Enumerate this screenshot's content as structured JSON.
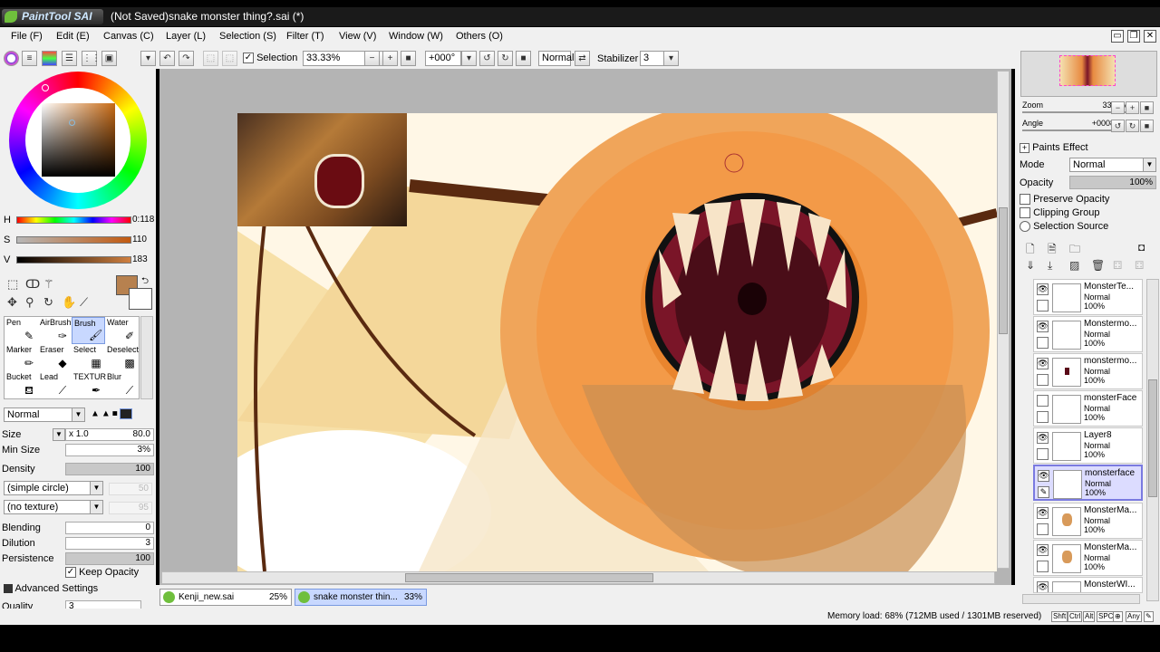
{
  "app": {
    "logo_text": "PaintTool SAI",
    "window_title": "(Not Saved)snake monster thing?.sai (*)"
  },
  "menu": [
    "File (F)",
    "Edit (E)",
    "Canvas (C)",
    "Layer (L)",
    "Selection (S)",
    "Filter (T)",
    "View (V)",
    "Window (W)",
    "Others (O)"
  ],
  "toolbar": {
    "selection_label": "Selection",
    "zoom": "33.33%",
    "angle": "+000°",
    "blend_mode": "Normal",
    "stabilizer_label": "Stabilizer",
    "stabilizer_value": "3"
  },
  "color": {
    "h_label": "H",
    "h_value": "0:118",
    "s_label": "S",
    "s_value": "110",
    "v_label": "V",
    "v_value": "183",
    "primary": "#b7814f"
  },
  "tools": [
    {
      "name": "Pen",
      "icon": "pen-icon"
    },
    {
      "name": "AirBrush",
      "icon": "airbrush-icon"
    },
    {
      "name": "Brush",
      "icon": "brush-icon"
    },
    {
      "name": "Water",
      "icon": "water-icon"
    },
    {
      "name": "Marker",
      "icon": "marker-icon"
    },
    {
      "name": "Eraser",
      "icon": "eraser-icon"
    },
    {
      "name": "Select",
      "icon": "select-icon"
    },
    {
      "name": "Deselect",
      "icon": "deselect-icon"
    },
    {
      "name": "Bucket",
      "icon": "bucket-icon"
    },
    {
      "name": "Lead",
      "icon": "lead-icon"
    },
    {
      "name": "TEXTUR",
      "icon": "texture-icon"
    },
    {
      "name": "Blur",
      "icon": "blur-icon"
    }
  ],
  "brush": {
    "mode": "Normal",
    "size_label": "Size",
    "size_mult": "x 1.0",
    "size_value": "80.0",
    "min_size_label": "Min Size",
    "min_size_value": "3%",
    "density_label": "Density",
    "density_value": "100",
    "shape": "(simple circle)",
    "shape_value": "50",
    "texture": "(no texture)",
    "texture_value": "95",
    "blending_label": "Blending",
    "blending_value": "0",
    "dilution_label": "Dilution",
    "dilution_value": "3",
    "persistence_label": "Persistence",
    "persistence_value": "100",
    "keep_opacity": "Keep Opacity",
    "advanced": "Advanced Settings",
    "quality_label": "Quality",
    "quality_value": "3"
  },
  "navigator": {
    "zoom_label": "Zoom",
    "zoom_value": "33.3%",
    "angle_label": "Angle",
    "angle_value": "+0008"
  },
  "layer_props": {
    "paints_effect": "Paints Effect",
    "mode_label": "Mode",
    "mode_value": "Normal",
    "opacity_label": "Opacity",
    "opacity_value": "100%",
    "preserve_opacity": "Preserve Opacity",
    "clipping_group": "Clipping Group",
    "selection_source": "Selection Source"
  },
  "layers": [
    {
      "name": "MonsterTe...",
      "mode": "Normal",
      "opacity": "100%"
    },
    {
      "name": "Monstermo...",
      "mode": "Normal",
      "opacity": "100%"
    },
    {
      "name": "monstermo...",
      "mode": "Normal",
      "opacity": "100%"
    },
    {
      "name": "monsterFace",
      "mode": "Normal",
      "opacity": "100%"
    },
    {
      "name": "Layer8",
      "mode": "Normal",
      "opacity": "100%"
    },
    {
      "name": "monsterface",
      "mode": "Normal",
      "opacity": "100%"
    },
    {
      "name": "MonsterMa...",
      "mode": "Normal",
      "opacity": "100%"
    },
    {
      "name": "MonsterMa...",
      "mode": "Normal",
      "opacity": "100%"
    },
    {
      "name": "MonsterWI...",
      "mode": "",
      "opacity": ""
    }
  ],
  "doc_tabs": [
    {
      "name": "Kenji_new.sai",
      "zoom": "25%"
    },
    {
      "name": "snake monster thin...",
      "zoom": "33%"
    }
  ],
  "status": {
    "memory": "Memory load: 68% (712MB used / 1301MB reserved)",
    "keys": [
      "Shft",
      "Ctrl",
      "Alt",
      "SPC",
      "⊕",
      "Any"
    ]
  }
}
